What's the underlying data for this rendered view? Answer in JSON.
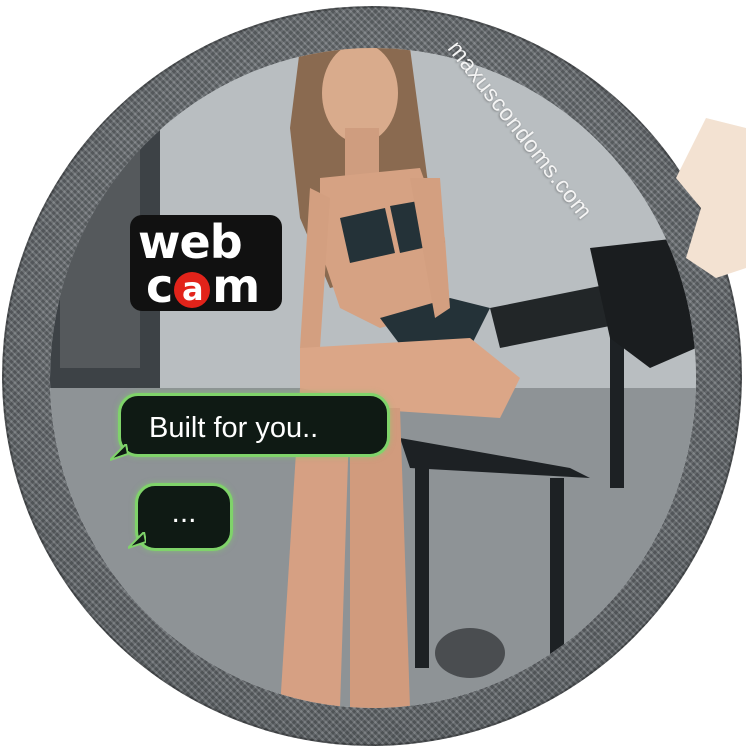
{
  "brand": {
    "url": "maxuscondoms.com",
    "logo": {
      "line1": "web",
      "line2_prefix": "c",
      "line2_highlight": "a",
      "line2_suffix": "m"
    }
  },
  "chat": {
    "message": "Built for you..",
    "typing": "..."
  },
  "colors": {
    "logo_background": "#111111",
    "logo_accent": "#e2231a",
    "bubble_background": "#0f1a14",
    "bubble_border": "#7fd36a",
    "wrapper": "#6d7276"
  }
}
